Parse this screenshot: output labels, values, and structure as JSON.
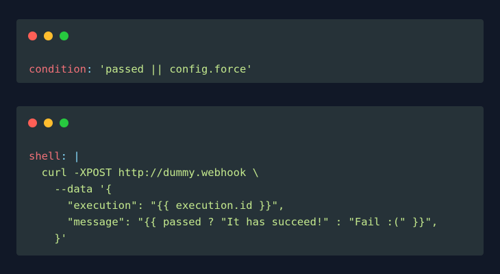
{
  "colors": {
    "background": "#111827",
    "window": "#263238",
    "dot_red": "#ff5f56",
    "dot_yellow": "#ffbd2e",
    "dot_green": "#27c93f",
    "key": "#f07178",
    "punct": "#89ddff",
    "string": "#c3e88d"
  },
  "window1": {
    "dots": [
      "close-dot",
      "minimize-dot",
      "maximize-dot"
    ],
    "code": {
      "key": "condition",
      "colon": ":",
      "value": " 'passed || config.force'"
    }
  },
  "window2": {
    "dots": [
      "close-dot",
      "minimize-dot",
      "maximize-dot"
    ],
    "code": {
      "key": "shell",
      "colon": ":",
      "pipe": " |",
      "lines": [
        "  curl -XPOST http://dummy.webhook \\",
        "    --data '{",
        "      \"execution\": \"{{ execution.id }}\",",
        "      \"message\": \"{{ passed ? \"It has succeed!\" : \"Fail :(\" }}\",",
        "    }'"
      ]
    }
  }
}
